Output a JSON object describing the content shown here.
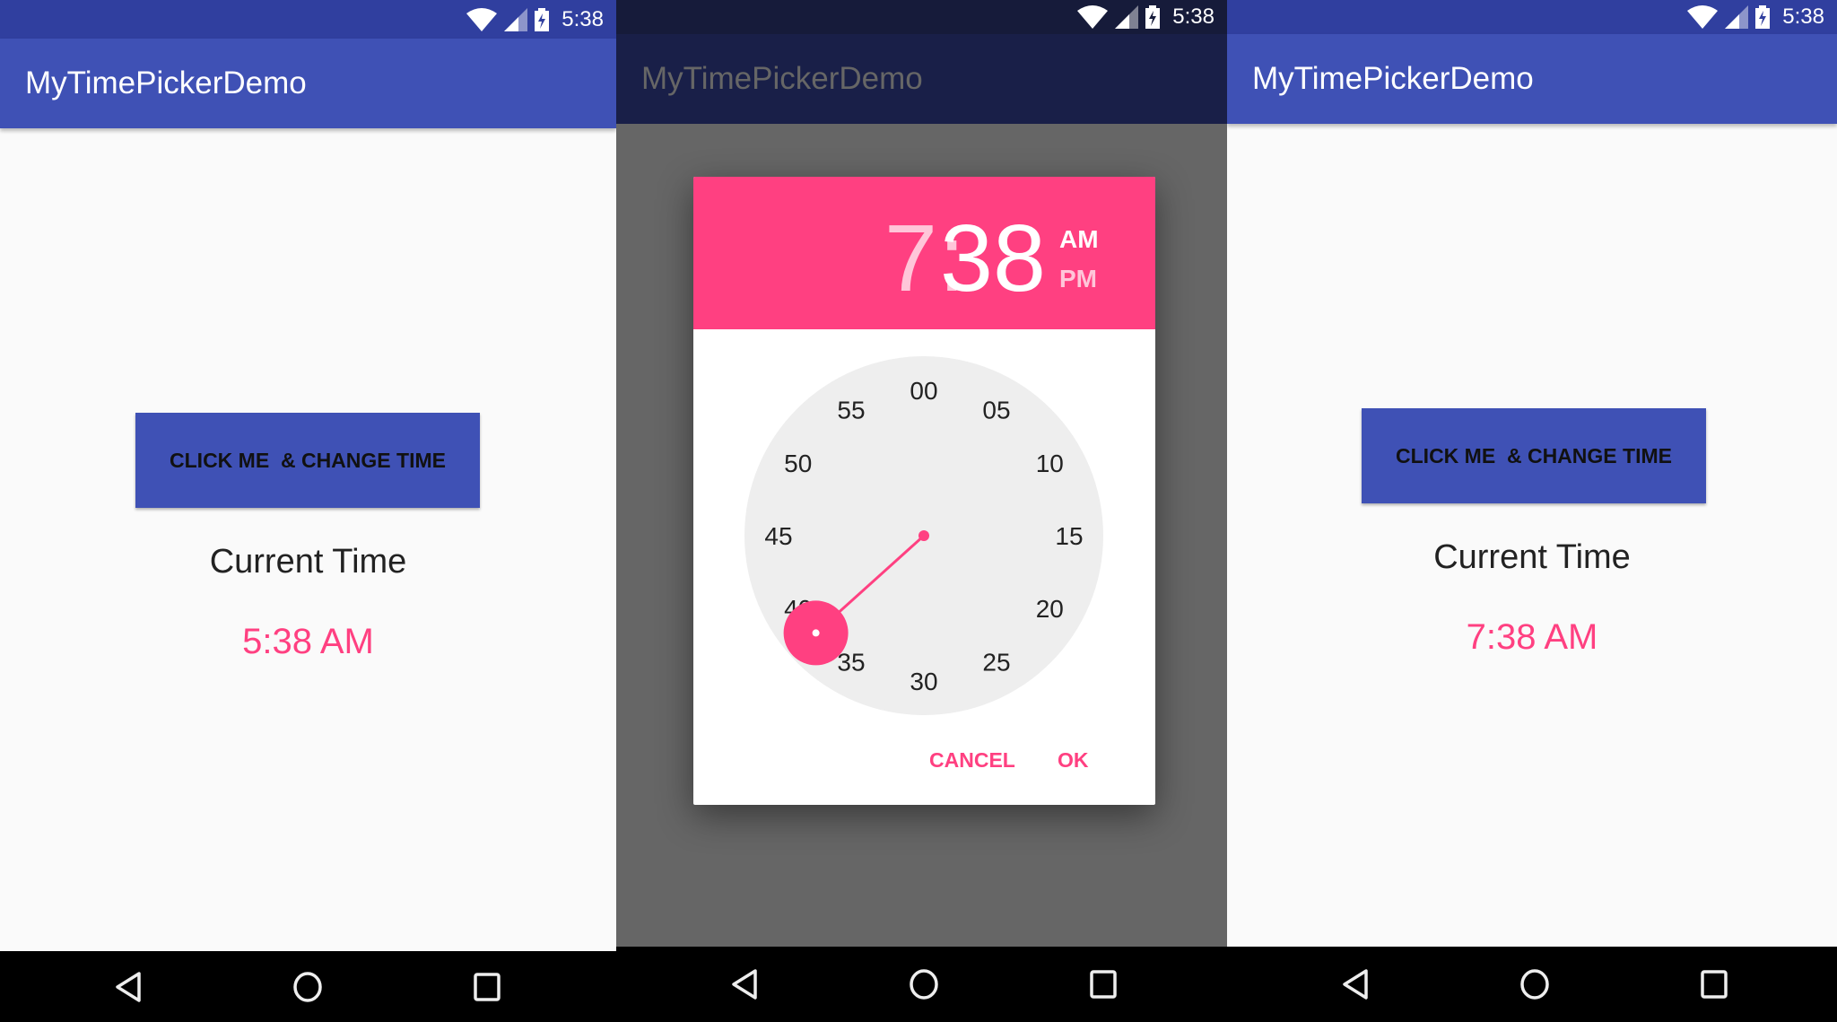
{
  "app_title": "MyTimePickerDemo",
  "status_time": "5:38",
  "colors": {
    "primary": "#3f51b5",
    "primary_dark": "#303f9f",
    "accent": "#ff4081",
    "scrim": "#666666"
  },
  "screens": [
    {
      "button_label": "CLICK ME  & CHANGE TIME",
      "current_time_label": "Current Time",
      "current_time_value": "5:38 AM"
    },
    {
      "dialog": {
        "hour": "7",
        "separator": ":",
        "minute": "38",
        "am_label": "AM",
        "pm_label": "PM",
        "selected_period": "AM",
        "selected_minute": 38,
        "minute_labels": [
          "00",
          "05",
          "10",
          "15",
          "20",
          "25",
          "30",
          "35",
          "40",
          "45",
          "50",
          "55"
        ],
        "cancel_label": "CANCEL",
        "ok_label": "OK"
      }
    },
    {
      "button_label": "CLICK ME  & CHANGE TIME",
      "current_time_label": "Current Time",
      "current_time_value": "7:38 AM"
    }
  ],
  "nav_icons": [
    "back-icon",
    "home-icon",
    "recents-icon"
  ]
}
